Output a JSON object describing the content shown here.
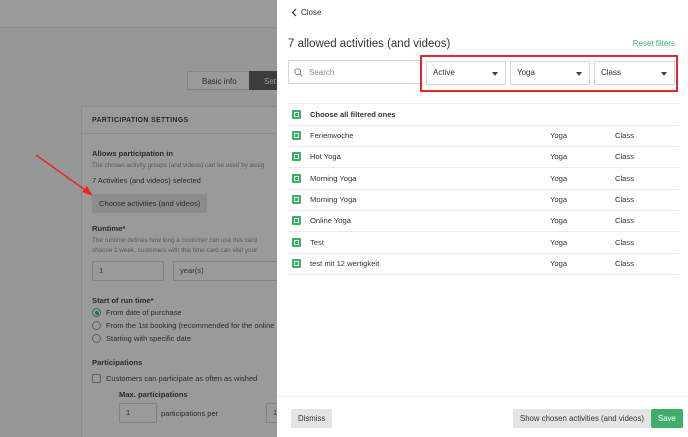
{
  "background": {
    "tabs": [
      "Basic info",
      "Set"
    ],
    "card_title": "PARTICIPATION SETTINGS",
    "allows_label": "Allows participation in",
    "allows_hint": "The chosen activity groups (and videos) can be used by assig",
    "selected_count": "7 Activities (and videos) selected",
    "choose_button": "Choose activities (and videos)",
    "runtime_label": "Runtime*",
    "runtime_hint_1": "The runtime defines how long a customer can use this card",
    "runtime_hint_2": "choose 1 week, customers with this time card can visit your",
    "runtime_value": "1",
    "runtime_unit": "year(s)",
    "start_label": "Start of run time*",
    "start_options": [
      "From date of purchase",
      "From the 1st booking (recommended for the online",
      "Starting with specific date"
    ],
    "participations_label": "Participations",
    "participate_check": "Customers can participate as often as wished",
    "max_label": "Max. participations",
    "max_value": "1",
    "per_label": "participations per",
    "per_value": "1"
  },
  "panel": {
    "close_label": "Close",
    "title": "7 allowed activities (and videos)",
    "reset_label": "Reset filters",
    "search_placeholder": "Search",
    "filters": {
      "status": "Active",
      "group": "Yoga",
      "type": "Class"
    },
    "choose_all_label": "Choose all filtered ones",
    "rows": [
      {
        "name": "Ferienwoche",
        "group": "Yoga",
        "type": "Class"
      },
      {
        "name": "Hot Yoga",
        "group": "Yoga",
        "type": "Class"
      },
      {
        "name": "Morning Yoga",
        "group": "Yoga",
        "type": "Class"
      },
      {
        "name": "Morning Yoga",
        "group": "Yoga",
        "type": "Class"
      },
      {
        "name": "Online Yoga",
        "group": "Yoga",
        "type": "Class"
      },
      {
        "name": "Test",
        "group": "Yoga",
        "type": "Class"
      },
      {
        "name": "test mit 12 wertigkeit",
        "group": "Yoga",
        "type": "Class"
      }
    ],
    "buttons": {
      "dismiss": "Dismiss",
      "show_chosen": "Show chosen activities (and videos)",
      "save": "Save"
    }
  },
  "colors": {
    "accent": "#3fae6a",
    "highlight": "#e22a2a"
  }
}
